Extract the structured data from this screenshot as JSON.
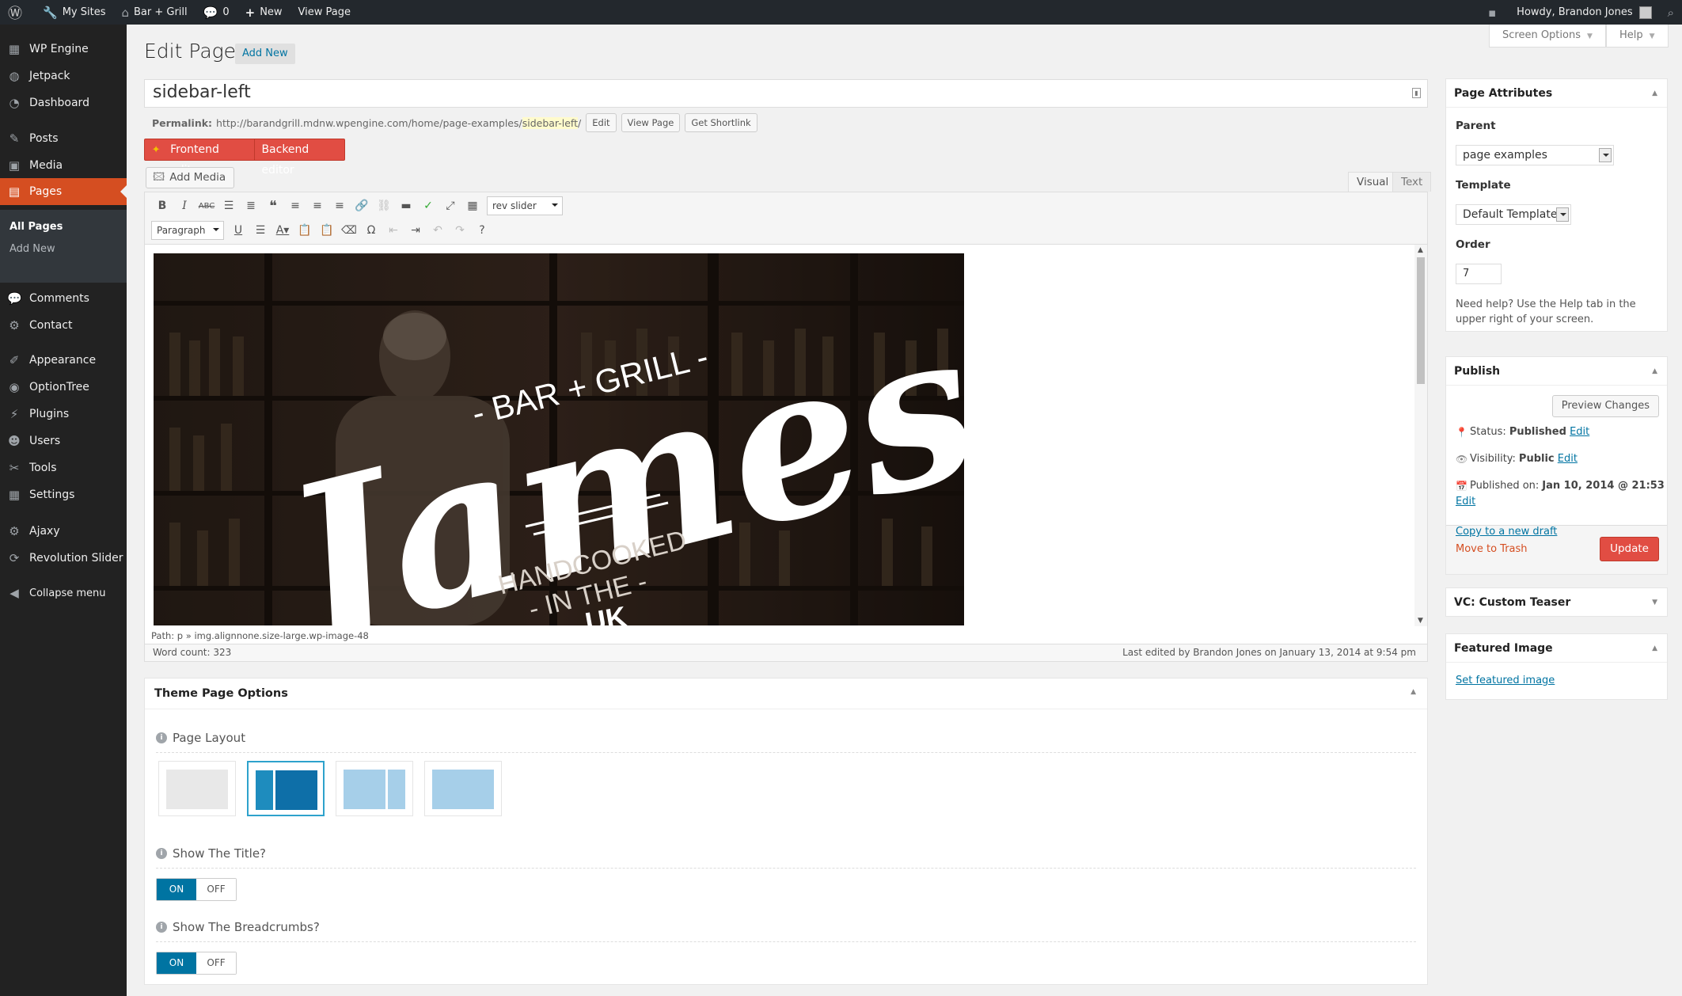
{
  "adminbar": {
    "my_sites": "My Sites",
    "site_name": "Bar + Grill",
    "comments_count": "0",
    "new_label": "New",
    "view_page": "View Page",
    "howdy": "Howdy, Brandon Jones"
  },
  "menu": {
    "items": [
      {
        "label": "WP Engine",
        "icon": "wpengine-icon"
      },
      {
        "label": "Jetpack",
        "icon": "jetpack-icon"
      },
      {
        "label": "Dashboard",
        "icon": "dashboard-icon"
      },
      {
        "label": "Posts",
        "icon": "pin-icon"
      },
      {
        "label": "Media",
        "icon": "media-icon"
      },
      {
        "label": "Pages",
        "icon": "pages-icon"
      },
      {
        "label": "Comments",
        "icon": "comments-icon"
      },
      {
        "label": "Contact",
        "icon": "gear-icon"
      },
      {
        "label": "Appearance",
        "icon": "brush-icon"
      },
      {
        "label": "OptionTree",
        "icon": "optiontree-icon"
      },
      {
        "label": "Plugins",
        "icon": "plugin-icon"
      },
      {
        "label": "Users",
        "icon": "users-icon"
      },
      {
        "label": "Tools",
        "icon": "wrench-icon"
      },
      {
        "label": "Settings",
        "icon": "settings-icon"
      },
      {
        "label": "Ajaxy",
        "icon": "gear-icon"
      },
      {
        "label": "Revolution Slider",
        "icon": "refresh-icon"
      },
      {
        "label": "Collapse menu",
        "icon": "collapse-icon"
      }
    ],
    "sub": {
      "all_pages": "All Pages",
      "add_new": "Add New"
    }
  },
  "header": {
    "title": "Edit Page",
    "add_new": "Add New",
    "screen_options": "Screen Options",
    "help": "Help"
  },
  "post": {
    "title": "sidebar-left",
    "permalink_label": "Permalink:",
    "permalink_base": "http://barandgrill.mdnw.wpengine.com/home/page-examples/",
    "permalink_slug": "sidebar-left",
    "permalink_end": "/",
    "edit_btn": "Edit",
    "view_btn": "View Page",
    "shortlink_btn": "Get Shortlink"
  },
  "editor": {
    "frontend": "Frontend editor",
    "backend": "Backend editor",
    "add_media": "Add Media",
    "tab_visual": "Visual",
    "tab_text": "Text",
    "shortcode_select": "rev slider",
    "format_select": "Paragraph",
    "path": "Path: p » img.alignnone.size-large.wp-image-48",
    "word_count": "Word count: 323",
    "last_edited": "Last edited by Brandon Jones on January 13, 2014 at 9:54 pm"
  },
  "hero": {
    "script": "James",
    "tag_top": "- BAR + GRILL -",
    "line1": "HANDCOOKED",
    "line2": "- IN THE -",
    "line3": "UK"
  },
  "theme_options": {
    "title": "Theme Page Options",
    "page_layout": "Page Layout",
    "show_title": "Show The Title?",
    "show_breadcrumbs": "Show The Breadcrumbs?",
    "on": "ON",
    "off": "OFF"
  },
  "attributes": {
    "title": "Page Attributes",
    "parent_label": "Parent",
    "parent_value": "page examples",
    "template_label": "Template",
    "template_value": "Default Template",
    "order_label": "Order",
    "order_value": "7",
    "help": "Need help? Use the Help tab in the upper right of your screen."
  },
  "publish": {
    "title": "Publish",
    "preview": "Preview Changes",
    "status_label": "Status:",
    "status_value": "Published",
    "visibility_label": "Visibility:",
    "visibility_value": "Public",
    "published_label": "Published on:",
    "published_value": "Jan 10, 2014 @ 21:53",
    "edit": "Edit",
    "copy_draft": "Copy to a new draft",
    "trash": "Move to Trash",
    "update": "Update"
  },
  "vc_teaser": {
    "title": "VC: Custom Teaser"
  },
  "featured": {
    "title": "Featured Image",
    "set_link": "Set featured image"
  },
  "colors": {
    "accent": "#e14d43",
    "link": "#0074a2",
    "menu_bg": "#222222"
  }
}
